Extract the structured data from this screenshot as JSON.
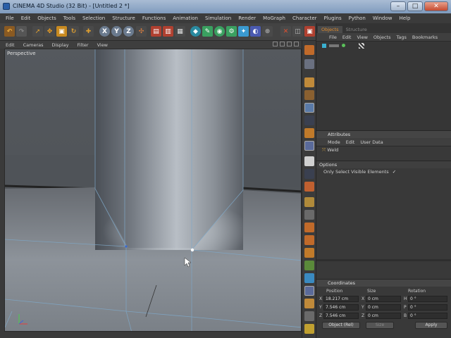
{
  "window": {
    "title": "CINEMA 4D Studio (32 Bit) - [Untitled 2 *]",
    "minimize": "–",
    "maximize": "□",
    "close": "✕"
  },
  "menu": [
    "File",
    "Edit",
    "Objects",
    "Tools",
    "Selection",
    "Structure",
    "Functions",
    "Animation",
    "Simulation",
    "Render",
    "MoGraph",
    "Character",
    "Plugins",
    "Python",
    "Window",
    "Help"
  ],
  "viewport": {
    "menu": [
      "Edit",
      "Cameras",
      "Display",
      "Filter",
      "View"
    ],
    "label": "Perspective"
  },
  "toolbar": {
    "axis_x": "X",
    "axis_y": "Y",
    "axis_z": "Z"
  },
  "objects": {
    "tabs": [
      "Objects",
      "Structure"
    ],
    "menu": [
      "File",
      "Edit",
      "View",
      "Objects",
      "Tags",
      "Bookmarks"
    ]
  },
  "attributes": {
    "title": "Attributes",
    "menu": [
      "Mode",
      "Edit",
      "User Data"
    ],
    "tool": "Weld",
    "options_title": "Options",
    "only_visible_label": "Only Select Visible Elements",
    "only_visible_checked": "✓"
  },
  "coordinates": {
    "title": "Coordinates",
    "headers": [
      "Position",
      "Size",
      "Rotation"
    ],
    "rows": [
      {
        "axis": "X",
        "pos": "18.217 cm",
        "size_axis": "X",
        "size": "0 cm",
        "rot_axis": "H",
        "rot": "0 °"
      },
      {
        "axis": "Y",
        "pos": "7.546 cm",
        "size_axis": "Y",
        "size": "0 cm",
        "rot_axis": "P",
        "rot": "0 °"
      },
      {
        "axis": "Z",
        "pos": "7.546 cm",
        "size_axis": "Z",
        "size": "0 cm",
        "rot_axis": "B",
        "rot": "0 °"
      }
    ],
    "mode": "Object (Rel)",
    "size_mode": "Size",
    "apply": "Apply"
  }
}
